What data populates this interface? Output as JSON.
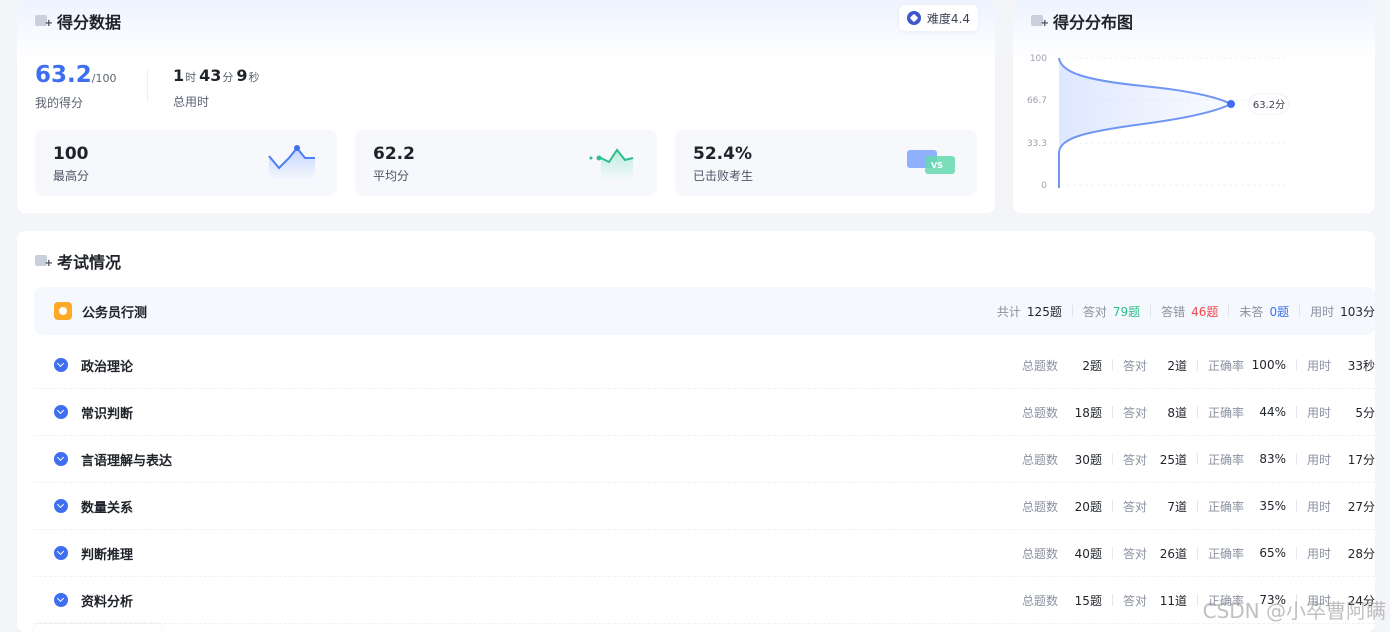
{
  "score_card": {
    "title": "得分数据",
    "difficulty": "难度4.4",
    "my_score": "63.2",
    "my_score_max": "/100",
    "my_score_label": "我的得分",
    "time": {
      "h": "1",
      "h_unit": "时",
      "m": "43",
      "m_unit": "分",
      "s": "9",
      "s_unit": "秒"
    },
    "time_label": "总用时",
    "stats": [
      {
        "value": "100",
        "label": "最高分"
      },
      {
        "value": "62.2",
        "label": "平均分"
      },
      {
        "value": "52.4%",
        "label": "已击败考生"
      }
    ],
    "vs_badge": "VS"
  },
  "distribution": {
    "title": "得分分布图",
    "y_ticks": [
      "100",
      "66.7",
      "33.3",
      "0"
    ],
    "marker_label": "63.2分"
  },
  "chart_data": {
    "type": "area",
    "title": "得分分布图",
    "y_ticks": [
      0,
      33.3,
      66.7,
      100
    ],
    "ylim": [
      0,
      100
    ],
    "highlight": {
      "score": 63.2,
      "label": "63.2分"
    }
  },
  "exam": {
    "title": "考试情况",
    "subject": "公务员行测",
    "summary": {
      "total_label": "共计",
      "total": "125题",
      "correct_label": "答对",
      "correct": "79题",
      "wrong_label": "答错",
      "wrong": "46题",
      "unanswered_label": "未答",
      "unanswered": "0题",
      "time_label": "用时",
      "time": "103分"
    },
    "labels": {
      "count": "总题数",
      "correct": "答对",
      "accuracy": "正确率",
      "time": "用时"
    },
    "sections": [
      {
        "name": "政治理论",
        "count": "2题",
        "correct": "2道",
        "accuracy": "100%",
        "time": "33秒"
      },
      {
        "name": "常识判断",
        "count": "18题",
        "correct": "8道",
        "accuracy": "44%",
        "time": "5分"
      },
      {
        "name": "言语理解与表达",
        "count": "30题",
        "correct": "25道",
        "accuracy": "83%",
        "time": "17分"
      },
      {
        "name": "数量关系",
        "count": "20题",
        "correct": "7道",
        "accuracy": "35%",
        "time": "27分"
      },
      {
        "name": "判断推理",
        "count": "40题",
        "correct": "26道",
        "accuracy": "65%",
        "time": "28分"
      },
      {
        "name": "资料分析",
        "count": "15题",
        "correct": "11道",
        "accuracy": "73%",
        "time": "24分"
      }
    ]
  },
  "watermark": "CSDN @小卒曹阿瞒",
  "colors": {
    "accent": "#3d6ff0",
    "green": "#2bbf8a",
    "red": "#f2484b",
    "orange": "#ffa928"
  }
}
